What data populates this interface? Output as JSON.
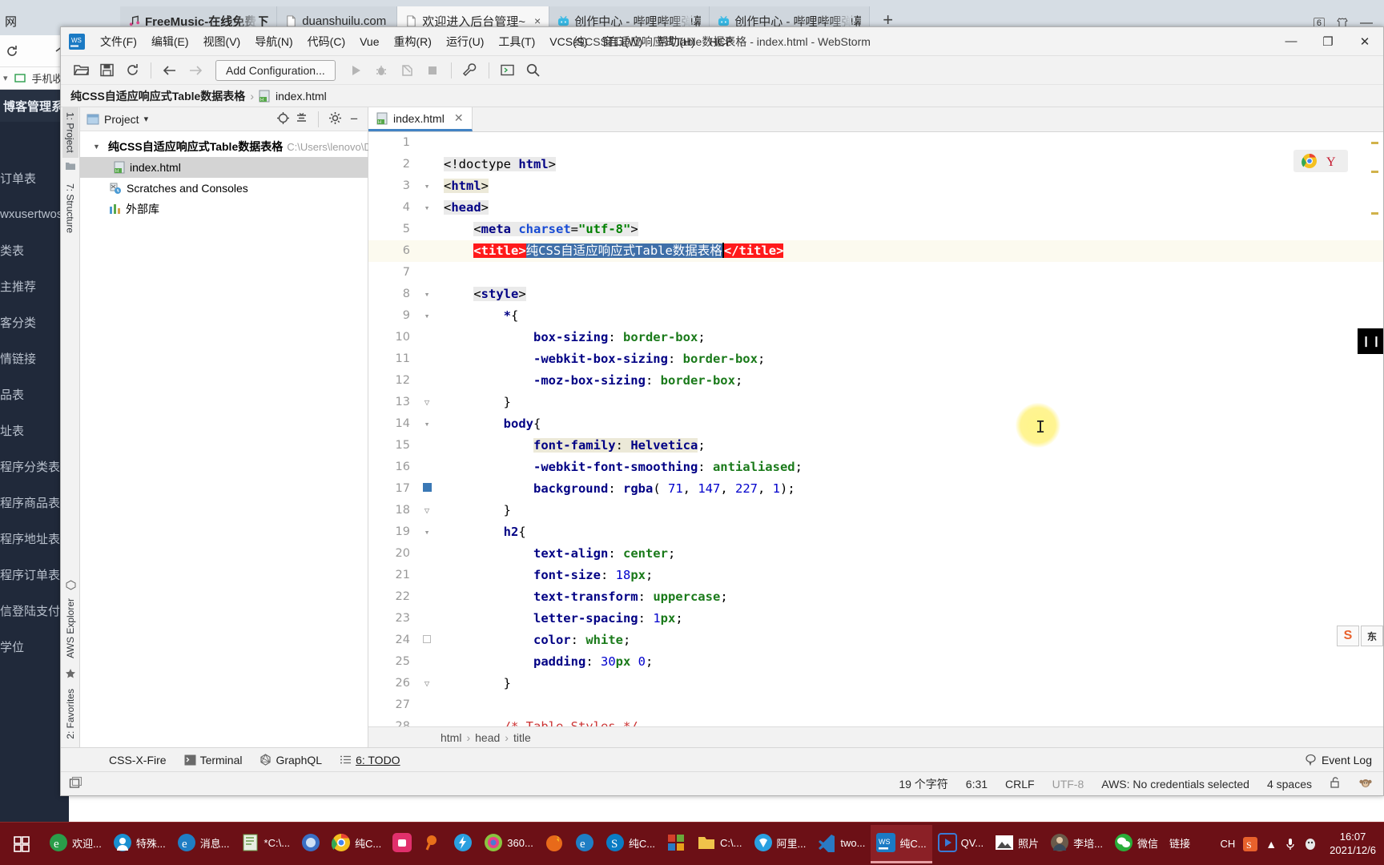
{
  "browser": {
    "tabs": [
      {
        "label": "FreeMusic-在线免费下",
        "icon": "music-icon",
        "active": false
      },
      {
        "label": "duanshuilu.com",
        "icon": "page-icon",
        "active": false
      },
      {
        "label": "欢迎进入后台管理~",
        "icon": "page-icon",
        "active": true
      },
      {
        "label": "创作中心 - 哔哩哔哩弹幕",
        "icon": "bilibili-icon",
        "active": false
      },
      {
        "label": "创作中心 - 哔哩哔哩弹幕",
        "icon": "bilibili-icon",
        "active": false
      }
    ],
    "new_tab_label": "+",
    "close_label": "×",
    "tab_count_badge": "6",
    "bookmark_label": "手机收",
    "left_edge_text": "网",
    "minimize_label": "—"
  },
  "bg_page": {
    "sidebar_title": "博客管理系统",
    "items": [
      "订单表",
      "wxusertwos",
      "类表",
      "主推荐",
      "客分类",
      "情链接",
      "品表",
      "址表",
      "程序分类表",
      "程序商品表",
      "程序地址表",
      "程序订单表",
      "信登陆支付",
      "学位"
    ]
  },
  "webstorm": {
    "window_title": "纯CSS自适应响应式Table数据表格 - index.html - WebStorm",
    "menu": [
      "文件(F)",
      "编辑(E)",
      "视图(V)",
      "导航(N)",
      "代码(C)",
      "Vue",
      "重构(R)",
      "运行(U)",
      "工具(T)",
      "VCS(S)",
      "窗口(W)",
      "帮助(H)",
      "HCP"
    ],
    "window_controls": {
      "minimize": "—",
      "maximize": "❐",
      "close": "✕"
    },
    "toolbar": {
      "open_icon": "open-folder-icon",
      "save_icon": "save-icon",
      "sync_icon": "refresh-icon",
      "back_icon": "arrow-left-icon",
      "forward_icon": "arrow-right-icon",
      "run_config_label": "Add Configuration...",
      "run_icon": "run-icon",
      "debug_icon": "debug-icon",
      "coverage_icon": "coverage-icon",
      "stop_icon": "stop-icon",
      "settings_icon": "wrench-icon",
      "console_icon": "terminal-icon",
      "search_icon": "search-icon"
    },
    "navbar": {
      "project": "纯CSS自适应响应式Table数据表格",
      "file": "index.html",
      "separator": "›"
    },
    "left_tool_tabs": [
      {
        "label": "1: Project",
        "selected": true
      },
      {
        "label": "7: Structure",
        "selected": false
      }
    ],
    "left_tool_tabs_bottom": [
      {
        "label": "2: Favorites",
        "selected": false
      },
      {
        "label": "AWS Explorer",
        "selected": false
      }
    ],
    "project_panel": {
      "title": "Project",
      "dropdown_icon": "chevron-down-icon",
      "locate_icon": "crosshair-icon",
      "collapse_icon": "collapse-all-icon",
      "settings_icon": "gear-icon",
      "hide_icon": "minus-icon",
      "tree": [
        {
          "label": "纯CSS自适应响应式Table数据表格",
          "path": "C:\\Users\\lenovo\\Des",
          "level": 0,
          "expanded": true,
          "icon": "folder-icon",
          "selected": false
        },
        {
          "label": "index.html",
          "path": "",
          "level": 1,
          "expanded": false,
          "icon": "html-file-icon",
          "selected": true
        },
        {
          "label": "Scratches and Consoles",
          "path": "",
          "level": 1,
          "expanded": false,
          "icon": "scratches-icon",
          "selected": false
        },
        {
          "label": "外部库",
          "path": "",
          "level": 1,
          "expanded": false,
          "icon": "library-icon",
          "selected": false
        }
      ]
    },
    "editor_tabs": [
      {
        "label": "index.html",
        "icon": "html-file-icon",
        "active": true,
        "close": "✕"
      }
    ],
    "code_lines": [
      {
        "n": 1,
        "text": ""
      },
      {
        "n": 2,
        "text": "<!doctype html>"
      },
      {
        "n": 3,
        "text": "<html>"
      },
      {
        "n": 4,
        "text": "<head>"
      },
      {
        "n": 5,
        "text": "    <meta charset=\"utf-8\">"
      },
      {
        "n": 6,
        "text": "    <title>纯CSS自适应响应式Table数据表格</title>"
      },
      {
        "n": 7,
        "text": ""
      },
      {
        "n": 8,
        "text": "    <style>"
      },
      {
        "n": 9,
        "text": "        *{"
      },
      {
        "n": 10,
        "text": "            box-sizing: border-box;"
      },
      {
        "n": 11,
        "text": "            -webkit-box-sizing: border-box;"
      },
      {
        "n": 12,
        "text": "            -moz-box-sizing: border-box;"
      },
      {
        "n": 13,
        "text": "        }"
      },
      {
        "n": 14,
        "text": "        body{"
      },
      {
        "n": 15,
        "text": "            font-family: Helvetica;"
      },
      {
        "n": 16,
        "text": "            -webkit-font-smoothing: antialiased;"
      },
      {
        "n": 17,
        "text": "            background: rgba( 71, 147, 227, 1);"
      },
      {
        "n": 18,
        "text": "        }"
      },
      {
        "n": 19,
        "text": "        h2{"
      },
      {
        "n": 20,
        "text": "            text-align: center;"
      },
      {
        "n": 21,
        "text": "            font-size: 18px;"
      },
      {
        "n": 22,
        "text": "            text-transform: uppercase;"
      },
      {
        "n": 23,
        "text": "            letter-spacing: 1px;"
      },
      {
        "n": 24,
        "text": "            color: white;"
      },
      {
        "n": 25,
        "text": "            padding: 30px 0;"
      },
      {
        "n": 26,
        "text": "        }"
      },
      {
        "n": 27,
        "text": ""
      },
      {
        "n": 28,
        "text": "        /* Table Styles */"
      }
    ],
    "current_line": 6,
    "breadcrumbs": [
      "html",
      "head",
      "title"
    ],
    "breadcrumb_separator": "›",
    "browser_popup": [
      "chrome-icon",
      "yandex-icon"
    ],
    "pause_badge": "❙❙",
    "tool_window_bar": [
      {
        "label": "CSS-X-Fire",
        "icon": ""
      },
      {
        "label": "Terminal",
        "icon": "terminal-icon"
      },
      {
        "label": "GraphQL",
        "icon": "graphql-icon"
      },
      {
        "label": "6: TODO",
        "icon": "todo-icon"
      }
    ],
    "event_log": {
      "label": "Event Log",
      "icon": "balloon-icon"
    },
    "status_bar": {
      "char_count": "19 个字符",
      "caret_position": "6:31",
      "line_separator": "CRLF",
      "encoding": "UTF-8",
      "aws": "AWS: No credentials selected",
      "indent": "4 spaces",
      "lock_icon": "unlock-icon",
      "monkey_icon": "monkey-icon"
    },
    "toolwin_hide_icon": "hide-window-icon"
  },
  "taskbar": {
    "start_icon": "start-icon",
    "items": [
      {
        "label": "欢迎...",
        "icon": "ie-icon",
        "active": false
      },
      {
        "label": "特殊...",
        "icon": "o-icon",
        "active": false
      },
      {
        "label": "消息...",
        "icon": "ie-icon",
        "active": false
      },
      {
        "label": "*C:\\...",
        "icon": "notepad-icon",
        "active": false
      },
      {
        "label": "",
        "icon": "ie2-icon",
        "active": false
      },
      {
        "label": "纯C...",
        "icon": "chrome-icon",
        "active": false
      },
      {
        "label": "",
        "icon": "camera-icon",
        "active": false
      },
      {
        "label": "",
        "icon": "magnifier-icon",
        "active": false
      },
      {
        "label": "",
        "icon": "thunder-icon",
        "active": false
      },
      {
        "label": "360...",
        "icon": "360-icon",
        "active": false
      },
      {
        "label": "",
        "icon": "firefox-icon",
        "active": false
      },
      {
        "label": "",
        "icon": "edge-icon",
        "active": false
      },
      {
        "label": "纯C...",
        "icon": "skype-icon",
        "active": false
      },
      {
        "label": "",
        "icon": "windows-icon",
        "active": false
      },
      {
        "label": "C:\\...",
        "icon": "folder-icon",
        "active": false
      },
      {
        "label": "阿里...",
        "icon": "aliwangwang-icon",
        "active": false
      },
      {
        "label": "two...",
        "icon": "vscode-icon",
        "active": false
      },
      {
        "label": "纯C...",
        "icon": "webstorm-icon",
        "active": true
      },
      {
        "label": "QV...",
        "icon": "qvod-icon",
        "active": false
      },
      {
        "label": "照片",
        "icon": "photos-icon",
        "active": false
      },
      {
        "label": "李培...",
        "icon": "avatar-icon",
        "active": false
      },
      {
        "label": "微信",
        "icon": "wechat-icon",
        "active": false
      },
      {
        "label": "链接",
        "icon": "",
        "active": false
      }
    ],
    "tray": {
      "ime": "CH",
      "sogou_icon": "sogou-icon",
      "chevron_icon": "chevron-up-icon",
      "mic_icon": "microphone-icon",
      "qq_icon": "qq-icon"
    },
    "clock": {
      "time": "16:07",
      "date": "2021/12/6"
    }
  },
  "colors": {
    "accent": "#4283c4",
    "error": "#ff1a1a",
    "selection": "#3f6fa8",
    "taskbar": "#6c1016",
    "sidebar": "#20293a"
  }
}
